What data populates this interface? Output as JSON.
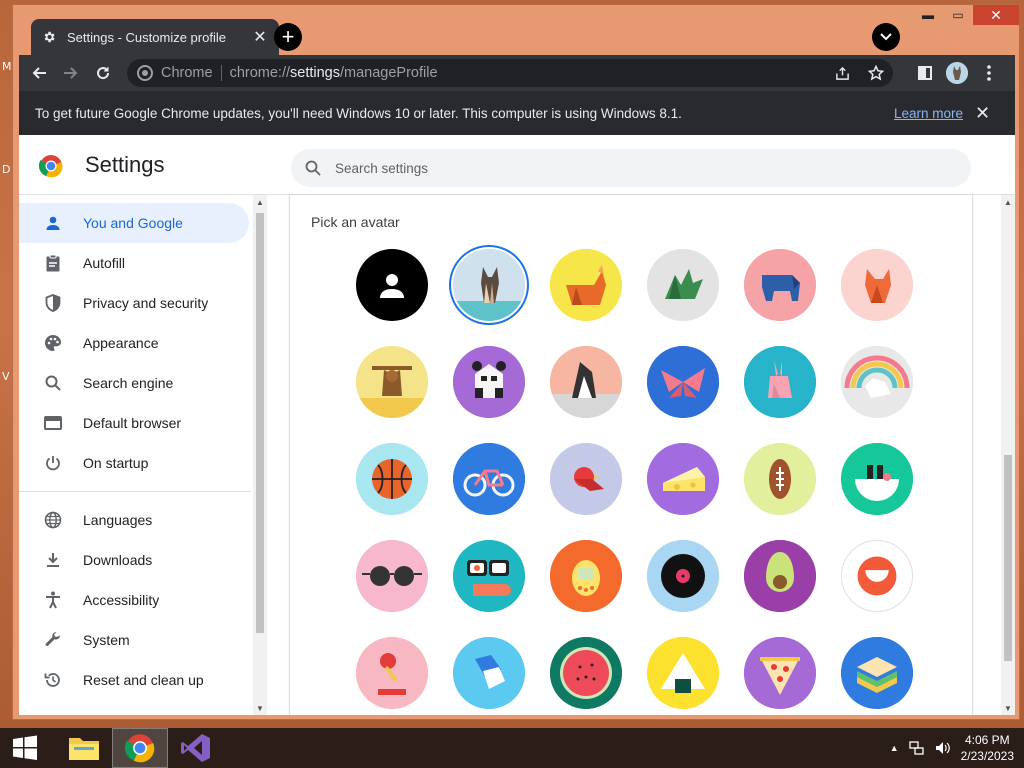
{
  "window": {
    "tab_title": "Settings - Customize profile",
    "controls": {
      "minimize": "▬",
      "maximize": "▭",
      "close": "✕"
    }
  },
  "toolbar": {
    "omnibox_chip": "Chrome",
    "url_scheme": "chrome://",
    "url_host": "settings",
    "url_path": "/manageProfile"
  },
  "infobar": {
    "message": "To get future Google Chrome updates, you'll need Windows 10 or later. This computer is using Windows 8.1.",
    "learn_more": "Learn more"
  },
  "settings": {
    "title": "Settings",
    "search_placeholder": "Search settings"
  },
  "sidebar": {
    "items": [
      {
        "label": "You and Google",
        "icon": "person-icon",
        "active": true
      },
      {
        "label": "Autofill",
        "icon": "clipboard-icon"
      },
      {
        "label": "Privacy and security",
        "icon": "shield-icon"
      },
      {
        "label": "Appearance",
        "icon": "palette-icon"
      },
      {
        "label": "Search engine",
        "icon": "search-icon"
      },
      {
        "label": "Default browser",
        "icon": "browser-icon"
      },
      {
        "label": "On startup",
        "icon": "power-icon"
      },
      {
        "label": "Languages",
        "icon": "globe-icon"
      },
      {
        "label": "Downloads",
        "icon": "download-icon"
      },
      {
        "label": "Accessibility",
        "icon": "accessibility-icon"
      },
      {
        "label": "System",
        "icon": "wrench-icon"
      },
      {
        "label": "Reset and clean up",
        "icon": "history-icon"
      }
    ]
  },
  "main": {
    "pick_avatar_label": "Pick an avatar",
    "avatars": [
      {
        "name": "generic-person",
        "bg": "#000000"
      },
      {
        "name": "origami-cat",
        "bg": "#b9d5e6",
        "selected": true
      },
      {
        "name": "origami-fox",
        "bg": "#f6e64a"
      },
      {
        "name": "origami-dragon",
        "bg": "#e3e3e3"
      },
      {
        "name": "origami-elephant",
        "bg": "#f5a3a6"
      },
      {
        "name": "origami-fox-red",
        "bg": "#fbd3cf"
      },
      {
        "name": "origami-monkey",
        "bg": "#f5e38a"
      },
      {
        "name": "origami-panda",
        "bg": "#a56ad6"
      },
      {
        "name": "origami-penguin",
        "bg": "#f7b6a1"
      },
      {
        "name": "origami-butterfly",
        "bg": "#2d6fd6"
      },
      {
        "name": "origami-rabbit",
        "bg": "#27b3c9"
      },
      {
        "name": "origami-unicorn",
        "bg": "#d9d9d9"
      },
      {
        "name": "basketball",
        "bg": "#a8e6f0"
      },
      {
        "name": "bike",
        "bg": "#2f7be0"
      },
      {
        "name": "red-bird",
        "bg": "#c4c9e8"
      },
      {
        "name": "cheese",
        "bg": "#a36be0"
      },
      {
        "name": "football",
        "bg": "#e2ef9c"
      },
      {
        "name": "sushi-bowl",
        "bg": "#16c79a"
      },
      {
        "name": "sunglasses",
        "bg": "#f7b8cd"
      },
      {
        "name": "sushi",
        "bg": "#1fb8c2"
      },
      {
        "name": "tamagotchi",
        "bg": "#f46a2d"
      },
      {
        "name": "vinyl",
        "bg": "#a9d6f2"
      },
      {
        "name": "avocado",
        "bg": "#9b3fa8"
      },
      {
        "name": "smile",
        "bg": "#ffffff"
      },
      {
        "name": "ice-cream",
        "bg": "#f7b8c4"
      },
      {
        "name": "note-paper",
        "bg": "#5bc9f0"
      },
      {
        "name": "watermelon",
        "bg": "#0f7a63"
      },
      {
        "name": "onigiri",
        "bg": "#fce22e"
      },
      {
        "name": "pizza",
        "bg": "#a56ad6"
      },
      {
        "name": "sandwich",
        "bg": "#2f7be0"
      }
    ]
  },
  "taskbar": {
    "time": "4:06 PM",
    "date": "2/23/2023"
  }
}
